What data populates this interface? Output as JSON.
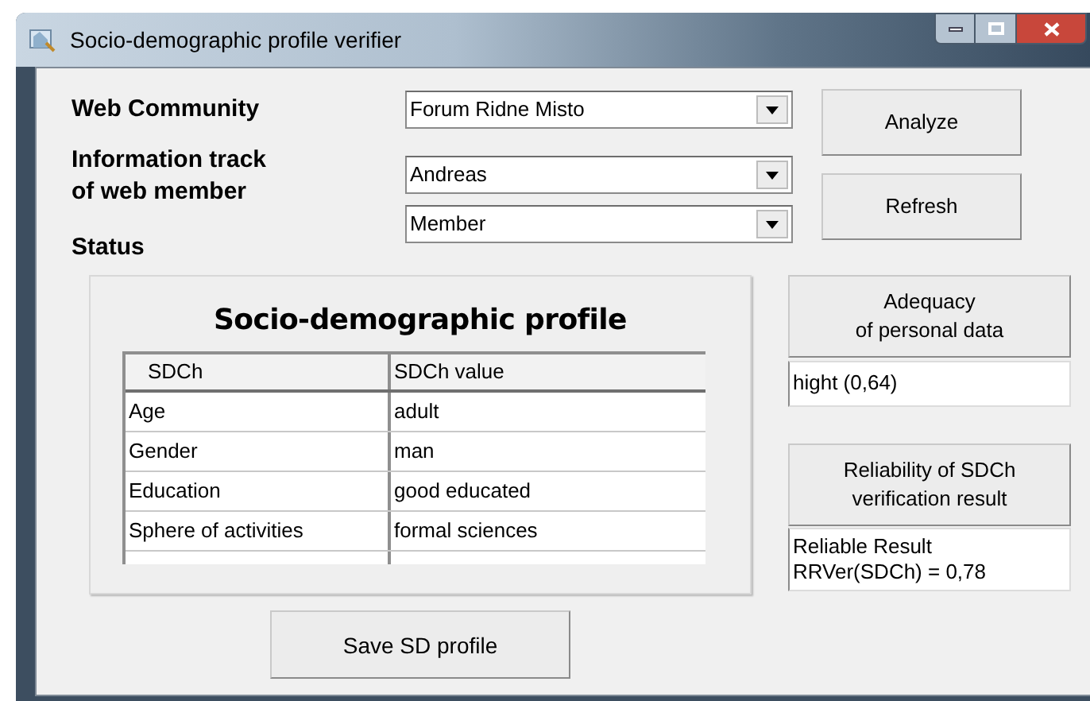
{
  "window": {
    "title": "Socio-demographic profile verifier"
  },
  "fields": [
    {
      "label": "Web Community",
      "value": "Forum Ridne Misto"
    },
    {
      "label": "Information track\nof web member",
      "value": "Andreas"
    },
    {
      "label": "Status",
      "value": "Member"
    }
  ],
  "buttons": [
    "Analyze",
    "Refresh"
  ],
  "profile": {
    "title": "Socio-demographic profile",
    "columns": [
      "SDCh",
      "SDCh value"
    ],
    "rows": [
      [
        "Age",
        "adult"
      ],
      [
        "Gender",
        "man"
      ],
      [
        "Education",
        "good educated"
      ],
      [
        "Sphere of activities",
        "formal sciences"
      ]
    ]
  },
  "adequacy": {
    "button": "Adequacy\nof personal data",
    "value": "hight (0,64)"
  },
  "reliability": {
    "button": "Reliability of SDCh\nverification result",
    "value": "Reliable Result\nRRVer(SDCh) = 0,78"
  },
  "save_button": "Save SD profile"
}
